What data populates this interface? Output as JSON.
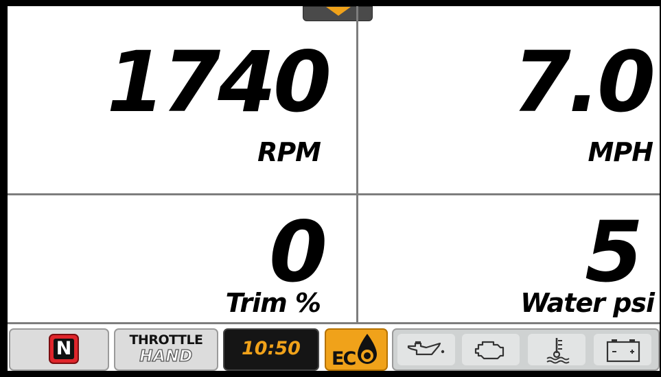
{
  "gauges": {
    "rpm": {
      "value": "1740",
      "unit": "RPM"
    },
    "speed": {
      "value": "7.0",
      "unit": "MPH"
    },
    "trim": {
      "value": "0",
      "unit": "Trim %"
    },
    "water": {
      "value": "5",
      "unit": "Water psi"
    }
  },
  "status_bar": {
    "gear": "N",
    "throttle_label": "THROTTLE",
    "throttle_mode": "HAND",
    "clock": "10:50",
    "eco_icon": "eco-icon",
    "indicators": [
      "oil-pressure-icon",
      "check-engine-icon",
      "water-temperature-icon",
      "battery-icon"
    ]
  },
  "colors": {
    "accent": "#f0a21a",
    "gear_badge": "#e0252b",
    "background": "#ffffff",
    "divider": "#7d7d7d"
  },
  "pull_tab_icon": "chevron-down-icon"
}
